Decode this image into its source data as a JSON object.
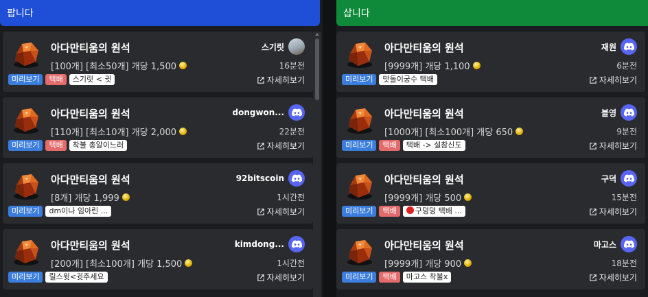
{
  "sell": {
    "header": "팝니다",
    "cards": [
      {
        "title": "아다만티움의 원석",
        "desc": "[100개] [최소50개] 개당 1,500",
        "user": "스기릿",
        "avatar": "photo",
        "time": "16분전",
        "preview": "미리보기",
        "delivery": "택배",
        "note": "스기릿 < 귓",
        "detail": "자세히보기"
      },
      {
        "title": "아다만티움의 원석",
        "desc": "[110개] [최소10개] 개당 2,000",
        "user": "dongwon...",
        "avatar": "discord",
        "time": "22분전",
        "preview": "미리보기",
        "delivery": "택배",
        "note": "착불 총알이느러",
        "detail": "자세히보기"
      },
      {
        "title": "아다만티움의 원석",
        "desc": "[8개] 개당 1,999",
        "user": "92bitscoin",
        "avatar": "discord",
        "time": "1시간전",
        "preview": "미리보기",
        "delivery": "",
        "note": "dm이나 임아린 ...",
        "detail": "자세히보기"
      },
      {
        "title": "아다만티움의 원석",
        "desc": "[200개] [최소100개] 개당 1,500",
        "user": "kimdong...",
        "avatar": "discord",
        "time": "1시간전",
        "preview": "미리보기",
        "delivery": "",
        "note": "릴스윗<귓주세요",
        "detail": "자세히보기"
      }
    ]
  },
  "buy": {
    "header": "삽니다",
    "cards": [
      {
        "title": "아다만티움의 원석",
        "desc": "[9999개] 개당 1,100",
        "user": "재원",
        "avatar": "discord",
        "time": "6분전",
        "preview": "미리보기",
        "delivery": "",
        "note": "맛돌이궁수 택배",
        "detail": "자세히보기"
      },
      {
        "title": "아다만티움의 원석",
        "desc": "[1000개] [최소100개] 개당 650",
        "user": "블영",
        "avatar": "discord",
        "time": "9분전",
        "preview": "미리보기",
        "delivery": "택배",
        "note": "택배 -> 설참신도",
        "detail": "자세히보기"
      },
      {
        "title": "아다만티움의 원석",
        "desc": "[9999개] 개당 500",
        "user": "구덕",
        "avatar": "discord",
        "time": "15분전",
        "preview": "미리보기",
        "delivery": "택배",
        "note": "구덩덩 택배 ...",
        "note_dot": true,
        "detail": "자세히보기"
      },
      {
        "title": "아다만티움의 원석",
        "desc": "[9999개] 개당 900",
        "user": "마고스",
        "avatar": "discord",
        "time": "18분전",
        "preview": "미리보기",
        "delivery": "택배",
        "note": "마고스 착불x",
        "detail": "자세히보기"
      }
    ]
  },
  "colors": {
    "sell_header": "#1f4fd6",
    "buy_header": "#0f8a3a",
    "preview_tag": "#3b7ddd",
    "delivery_tag": "#e36b6b",
    "discord": "#5865f2"
  }
}
